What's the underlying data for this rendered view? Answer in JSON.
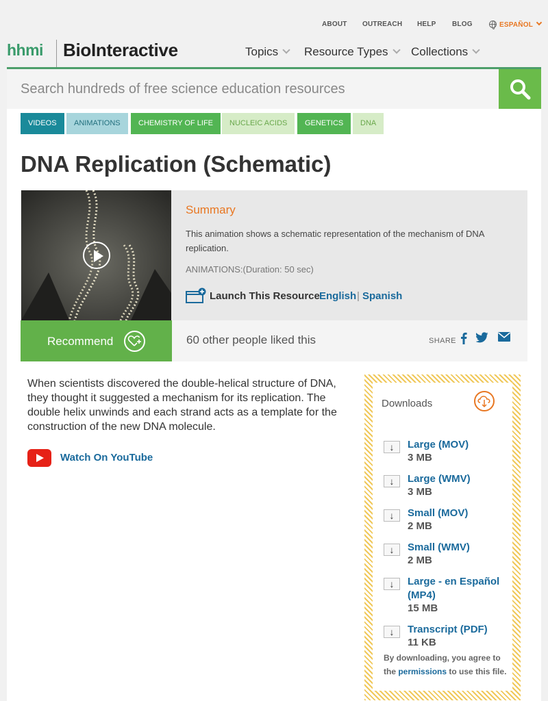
{
  "util_nav": {
    "about": "ABOUT",
    "outreach": "OUTREACH",
    "help": "HELP",
    "blog": "BLOG",
    "language": "ESPAÑOL"
  },
  "brand": {
    "hhmi": "hhmi",
    "name": "BioInteractive"
  },
  "main_nav": {
    "topics": "Topics",
    "resource_types": "Resource Types",
    "collections": "Collections"
  },
  "search": {
    "placeholder": "Search hundreds of free science education resources"
  },
  "tags": [
    "VIDEOS",
    "ANIMATIONS",
    "CHEMISTRY OF LIFE",
    "NUCLEIC ACIDS",
    "GENETICS",
    "DNA"
  ],
  "page_title": "DNA Replication (Schematic)",
  "summary": {
    "heading": "Summary",
    "text": "This animation shows a schematic representation of the mechanism of DNA replication.",
    "duration": "ANIMATIONS:(Duration: 50 sec)",
    "launch_label": "Launch This Resource",
    "english": "English",
    "separator": "|",
    "spanish": "Spanish"
  },
  "recommend": {
    "button_label": "Recommend",
    "liked_text": "60 other people liked this",
    "share_label": "SHARE"
  },
  "description": "When scientists discovered the double-helical structure of DNA, they thought it suggested a mechanism for its replication. The double helix unwinds and each strand acts as a template for the construction of the new DNA molecule.",
  "youtube_label": "Watch On YouTube",
  "downloads": {
    "title": "Downloads",
    "items": [
      {
        "name": "Large (MOV)",
        "size": "3 MB"
      },
      {
        "name": "Large (WMV)",
        "size": "3 MB"
      },
      {
        "name": "Small (MOV)",
        "size": "2 MB"
      },
      {
        "name": "Small (WMV)",
        "size": "2 MB"
      },
      {
        "name": "Large - en Español (MP4)",
        "size": "15 MB"
      },
      {
        "name": "Transcript (PDF)",
        "size": "11 KB"
      }
    ],
    "note_before": "By downloading, you agree to the",
    "note_link": "permissions",
    "note_after": "to use this file."
  },
  "colors": {
    "brand_green": "#3a9b6b",
    "accent_orange": "#e87722",
    "link_blue": "#1a6a9c",
    "search_green": "#6abb4a"
  }
}
